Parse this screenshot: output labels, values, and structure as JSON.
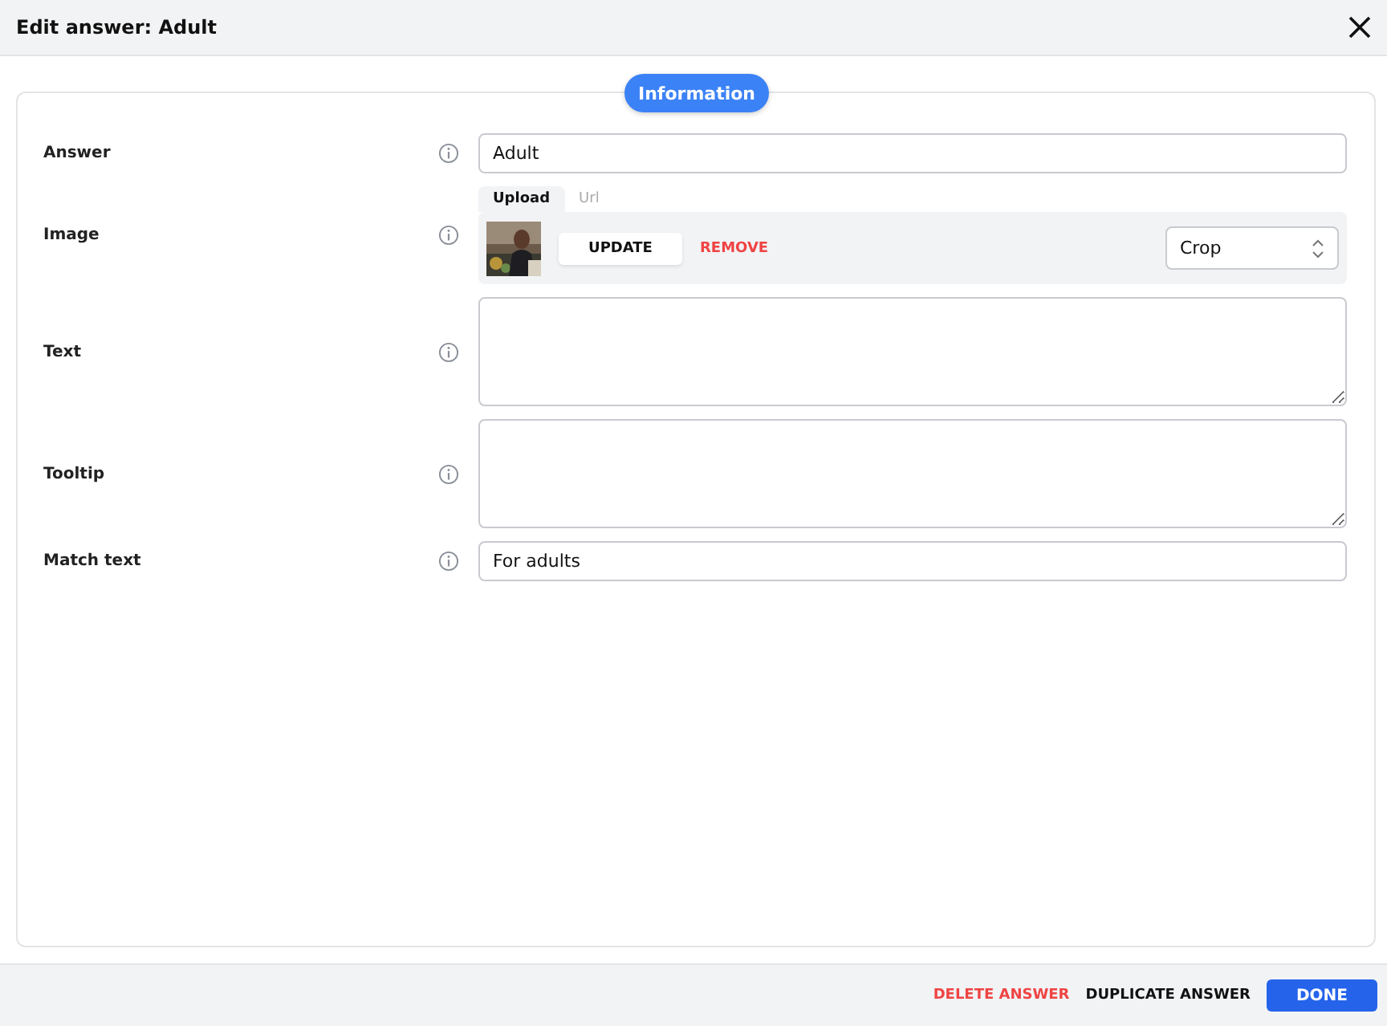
{
  "title": "Edit answer: Adult",
  "section_tab": "Information",
  "fields": [
    {
      "kind": "text",
      "label": "Answer",
      "value": "Adult"
    },
    {
      "label": "Image",
      "tabs": [
        {
          "label": "Upload",
          "selected": true
        },
        {
          "label": "Url",
          "selected": false
        }
      ],
      "update": "UPDATE",
      "remove": "REMOVE",
      "fit": "Crop"
    },
    {
      "kind": "textarea",
      "label": "Text"
    },
    {
      "kind": "textarea",
      "label": "Tooltip"
    },
    {
      "kind": "text",
      "label": "Match text",
      "value": "For adults"
    }
  ],
  "footer": {
    "delete": "DELETE ANSWER",
    "duplicate": "DUPLICATE ANSWER",
    "done": "DONE"
  }
}
